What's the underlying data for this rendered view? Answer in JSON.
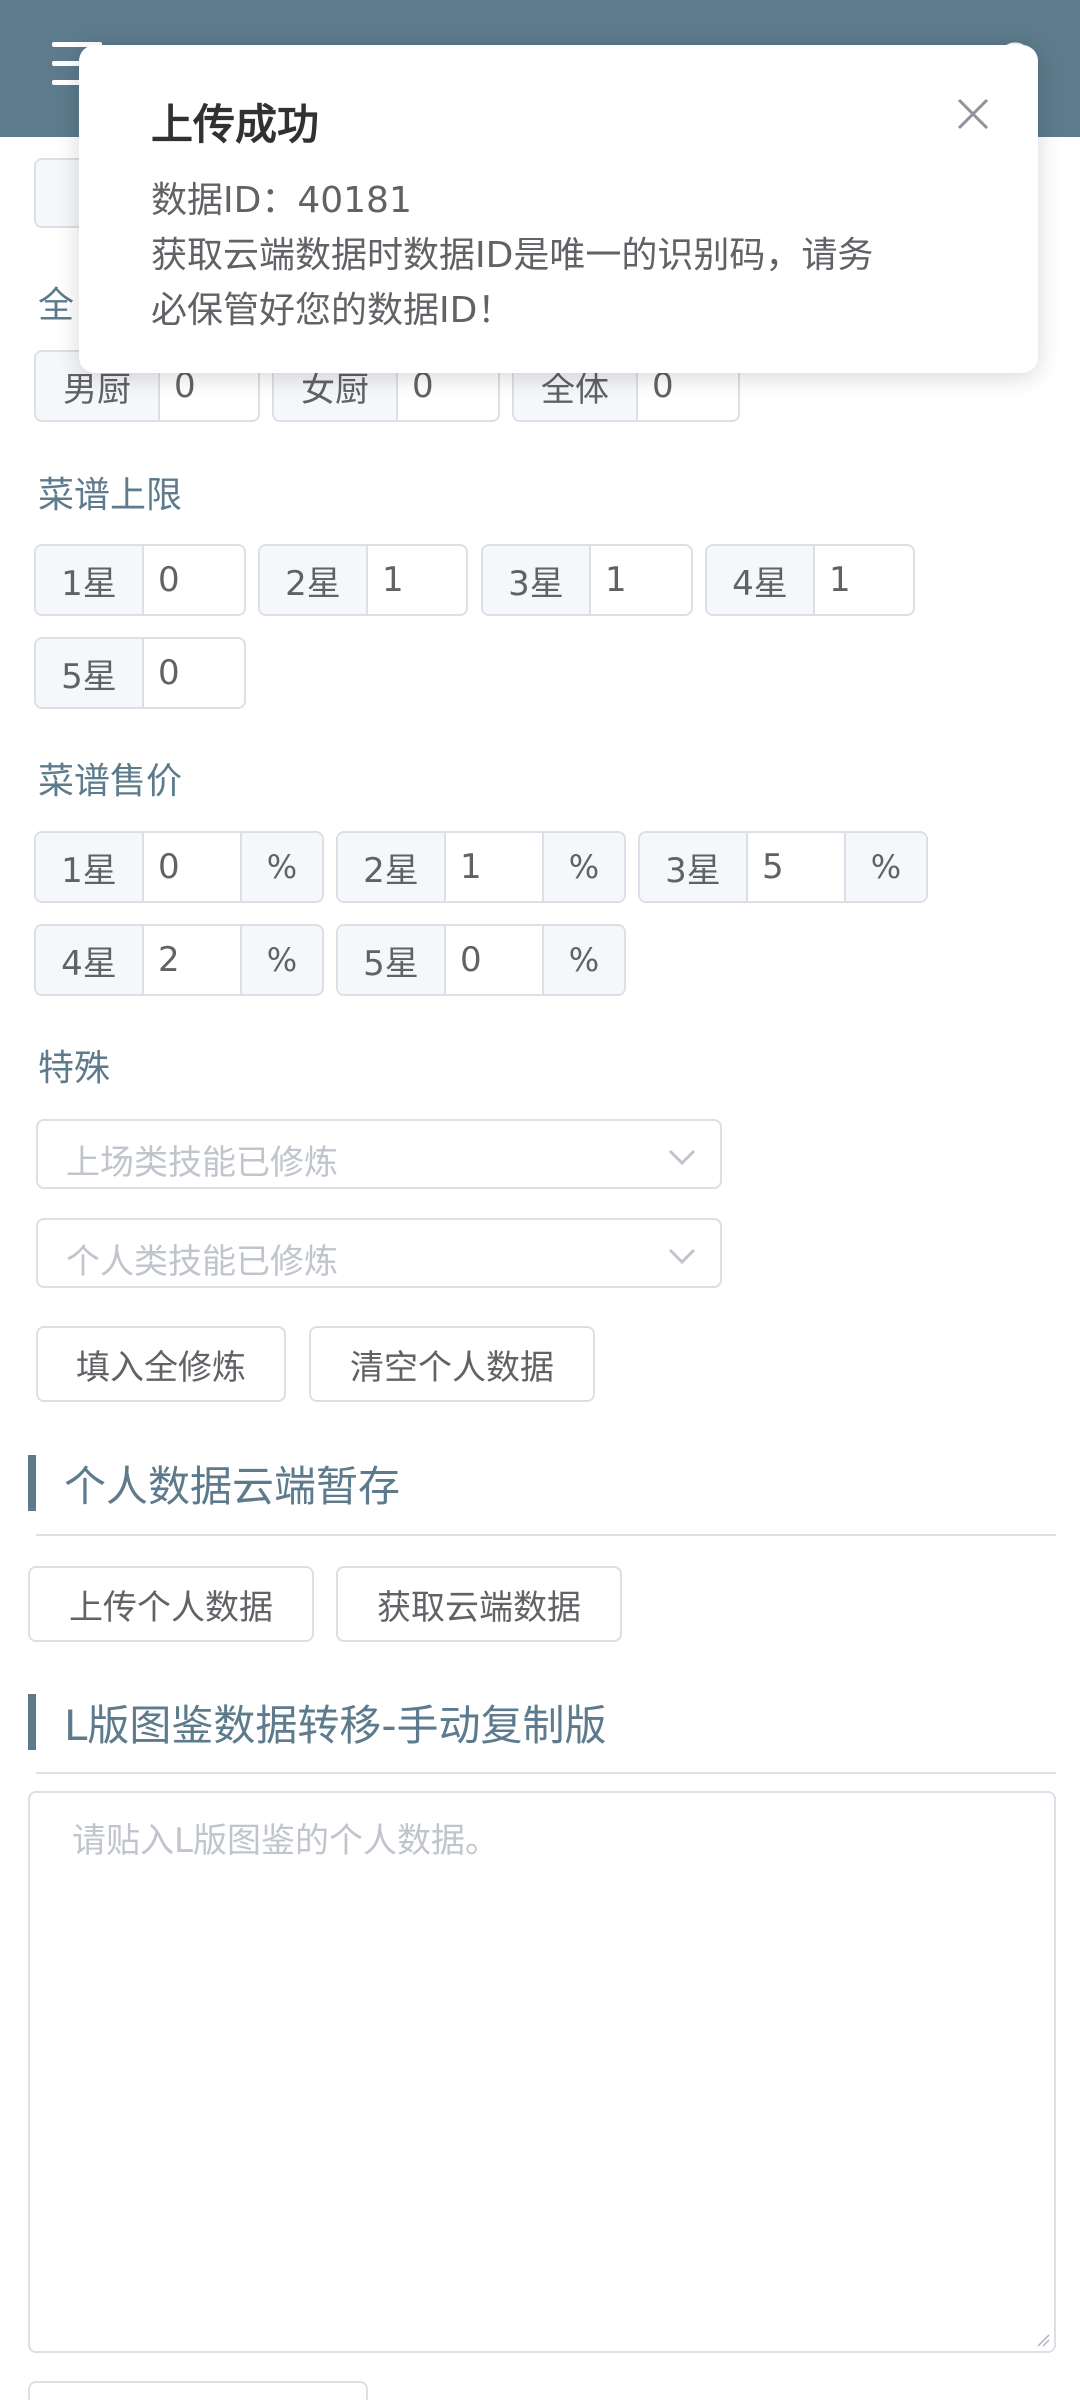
{
  "sections": {
    "recipe_limit": "菜谱上限",
    "recipe_price": "菜谱售价",
    "special": "特殊"
  },
  "chef_row": [
    {
      "label": "男厨",
      "value": "0"
    },
    {
      "label": "女厨",
      "value": "0"
    },
    {
      "label": "全体",
      "value": "0"
    }
  ],
  "recipe_limit": [
    {
      "label": "1星",
      "value": "0"
    },
    {
      "label": "2星",
      "value": "1"
    },
    {
      "label": "3星",
      "value": "1"
    },
    {
      "label": "4星",
      "value": "1"
    },
    {
      "label": "5星",
      "value": "0"
    }
  ],
  "recipe_price": [
    {
      "label": "1星",
      "value": "0",
      "unit": "%"
    },
    {
      "label": "2星",
      "value": "1",
      "unit": "%"
    },
    {
      "label": "3星",
      "value": "5",
      "unit": "%"
    },
    {
      "label": "4星",
      "value": "2",
      "unit": "%"
    },
    {
      "label": "5星",
      "value": "0",
      "unit": "%"
    }
  ],
  "selects": {
    "onfield_placeholder": "上场类技能已修炼",
    "personal_placeholder": "个人类技能已修炼"
  },
  "buttons": {
    "fill_all": "填入全修炼",
    "clear_personal": "清空个人数据",
    "upload": "上传个人数据",
    "fetch": "获取云端数据"
  },
  "headings": {
    "cloud": "个人数据云端暂存",
    "transfer": "L版图鉴数据转移-手动复制版"
  },
  "textarea": {
    "placeholder": "请贴入L版图鉴的个人数据。"
  },
  "notification": {
    "title": "上传成功",
    "line1": "数据ID：40181",
    "line2": "获取云端数据时数据ID是唯一的识别码，请务",
    "line3": "必保管好您的数据ID！"
  },
  "colors": {
    "primary": "#5d7b8c",
    "border": "#dcdfe6",
    "placeholder": "#c0c4cc",
    "text": "#606266"
  }
}
